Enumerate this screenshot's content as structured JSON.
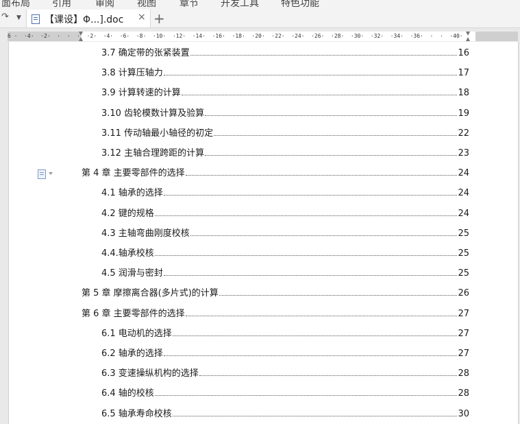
{
  "menu": {
    "items": [
      "面布局",
      "引用",
      "审阅",
      "视图",
      "章节",
      "开发工具",
      "特色功能"
    ]
  },
  "tabbar": {
    "tab_title": "【课设】Φ...].doc",
    "close_glyph": "×",
    "new_tab_glyph": "+"
  },
  "ruler": {
    "text": "6 ·  ·4·  ·2·  ·  ·  ·  ·2·  ·4·  ·6·  ·8·  ·10·  ·12·  ·14·  ·16·  ·18·  ·20·  ·22·  ·24·  ·26·  ·28·  ·30·  ·32·  ·34·  ·36·  ·  ·  ·40·"
  },
  "toc": [
    {
      "label": "3.7 确定带的张紧装置",
      "page": "16",
      "level": 2
    },
    {
      "label": "3.8 计算压轴力",
      "page": "17",
      "level": 2
    },
    {
      "label": "3.9  计算转速的计算",
      "page": "18",
      "level": 2
    },
    {
      "label": "3.10  齿轮模数计算及验算",
      "page": "19",
      "level": 2
    },
    {
      "label": "3.11  传动轴最小轴径的初定",
      "page": "22",
      "level": 2
    },
    {
      "label": "3.12  主轴合理跨距的计算",
      "page": "23",
      "level": 2
    },
    {
      "label": "第 4 章  主要零部件的选择",
      "page": "24",
      "level": 1
    },
    {
      "label": "4.1  轴承的选择",
      "page": "24",
      "level": 2
    },
    {
      "label": "4.2  键的规格",
      "page": "24",
      "level": 2
    },
    {
      "label": "4.3  主轴弯曲刚度校核",
      "page": "25",
      "level": 2
    },
    {
      "label": "4.4.轴承校核",
      "page": "25",
      "level": 2
    },
    {
      "label": "4.5  润滑与密封",
      "page": "25",
      "level": 2
    },
    {
      "label": "第 5 章   摩擦离合器(多片式)的计算",
      "page": "26",
      "level": 1
    },
    {
      "label": "第 6 章  主要零部件的选择",
      "page": "27",
      "level": 1
    },
    {
      "label": "6.1 电动机的选择",
      "page": "27",
      "level": 2
    },
    {
      "label": "6.2  轴承的选择",
      "page": "27",
      "level": 2
    },
    {
      "label": "6.3 变速操纵机构的选择",
      "page": "28",
      "level": 2
    },
    {
      "label": "6.4  轴的校核",
      "page": "28",
      "level": 2
    },
    {
      "label": "6.5  轴承寿命校核",
      "page": "30",
      "level": 2
    }
  ]
}
